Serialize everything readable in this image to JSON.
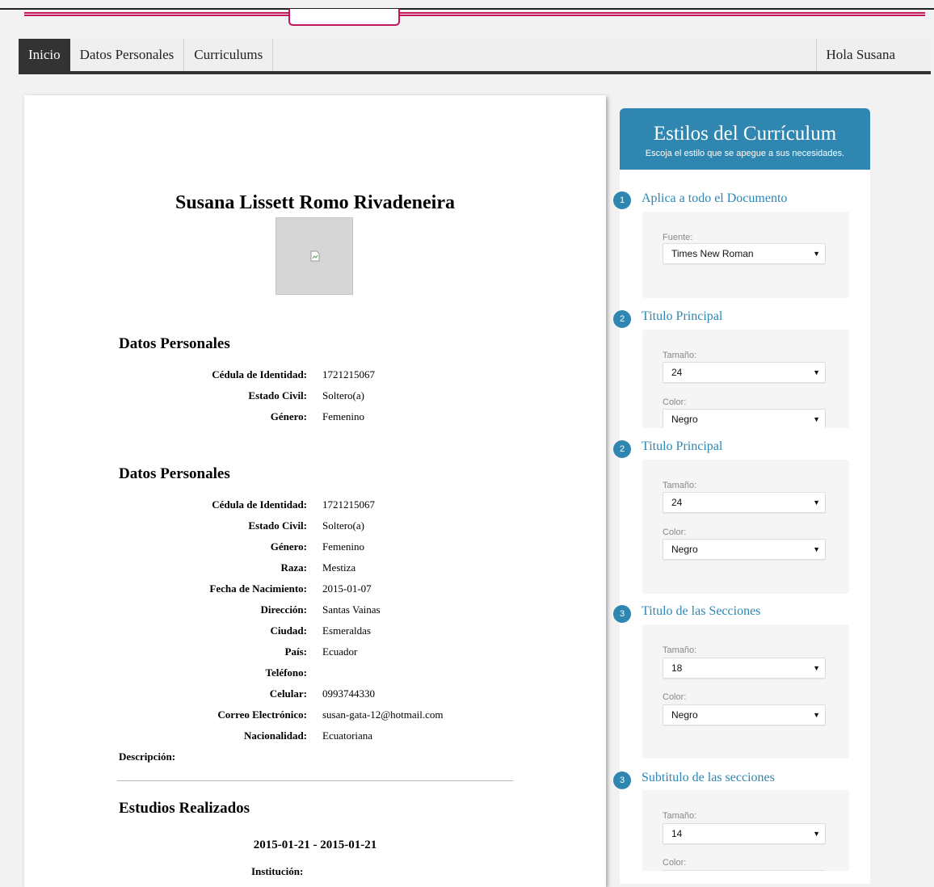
{
  "nav": {
    "items": [
      {
        "label": "Inicio"
      },
      {
        "label": "Datos Personales"
      },
      {
        "label": "Curriculums"
      }
    ],
    "user_greeting": "Hola Susana"
  },
  "document": {
    "name": "Susana Lissett Romo Rivadeneira",
    "section1": {
      "title": "Datos Personales",
      "rows": [
        {
          "label": "Cédula de Identidad:",
          "value": "1721215067"
        },
        {
          "label": "Estado Civil:",
          "value": "Soltero(a)"
        },
        {
          "label": "Género:",
          "value": "Femenino"
        }
      ]
    },
    "section2": {
      "title": "Datos Personales",
      "rows": [
        {
          "label": "Cédula de Identidad:",
          "value": "1721215067"
        },
        {
          "label": "Estado Civil:",
          "value": "Soltero(a)"
        },
        {
          "label": "Género:",
          "value": "Femenino"
        },
        {
          "label": "Raza:",
          "value": "Mestiza"
        },
        {
          "label": "Fecha de Nacimiento:",
          "value": "2015-01-07"
        },
        {
          "label": "Dirección:",
          "value": "Santas Vainas"
        },
        {
          "label": "Ciudad:",
          "value": "Esmeraldas"
        },
        {
          "label": "País:",
          "value": "Ecuador"
        },
        {
          "label": "Teléfono:",
          "value": ""
        },
        {
          "label": "Celular:",
          "value": "0993744330"
        },
        {
          "label": "Correo Electrónico:",
          "value": "susan-gata-12@hotmail.com"
        },
        {
          "label": "Nacionalidad:",
          "value": "Ecuatoriana"
        }
      ],
      "description_label": "Descripción:"
    },
    "section3": {
      "title": "Estudios Realizados",
      "period": "2015-01-21 - 2015-01-21",
      "institution_label": "Institución:"
    }
  },
  "panel": {
    "title": "Estilos del Currículum",
    "subtitle": "Escoja el estilo que se apegue a sus necesidades.",
    "groups": [
      {
        "step": "1",
        "title": "Aplica a todo el Documento",
        "fields": [
          {
            "label": "Fuente:",
            "value": "Times New Roman"
          }
        ]
      },
      {
        "step": "2",
        "title": "Titulo Principal",
        "fields": [
          {
            "label": "Tamaño:",
            "value": "24"
          },
          {
            "label": "Color:",
            "value": "Negro"
          }
        ]
      },
      {
        "step": "2",
        "title": "Titulo Principal",
        "fields": [
          {
            "label": "Tamaño:",
            "value": "24"
          },
          {
            "label": "Color:",
            "value": "Negro"
          }
        ]
      },
      {
        "step": "3",
        "title": "Titulo de las Secciones",
        "fields": [
          {
            "label": "Tamaño:",
            "value": "18"
          },
          {
            "label": "Color:",
            "value": "Negro"
          }
        ]
      },
      {
        "step": "3",
        "title": "Subtitulo de las secciones",
        "fields": [
          {
            "label": "Tamaño:",
            "value": "14"
          },
          {
            "label": "Color:",
            "value": ""
          }
        ]
      }
    ]
  },
  "icons": {
    "broken_image": "broken-image-icon",
    "dropdown": "dropdown-arrow-icon"
  },
  "colors": {
    "accent": "#2e86b1",
    "brand_line": "#c2185b",
    "nav_active": "#333333"
  }
}
